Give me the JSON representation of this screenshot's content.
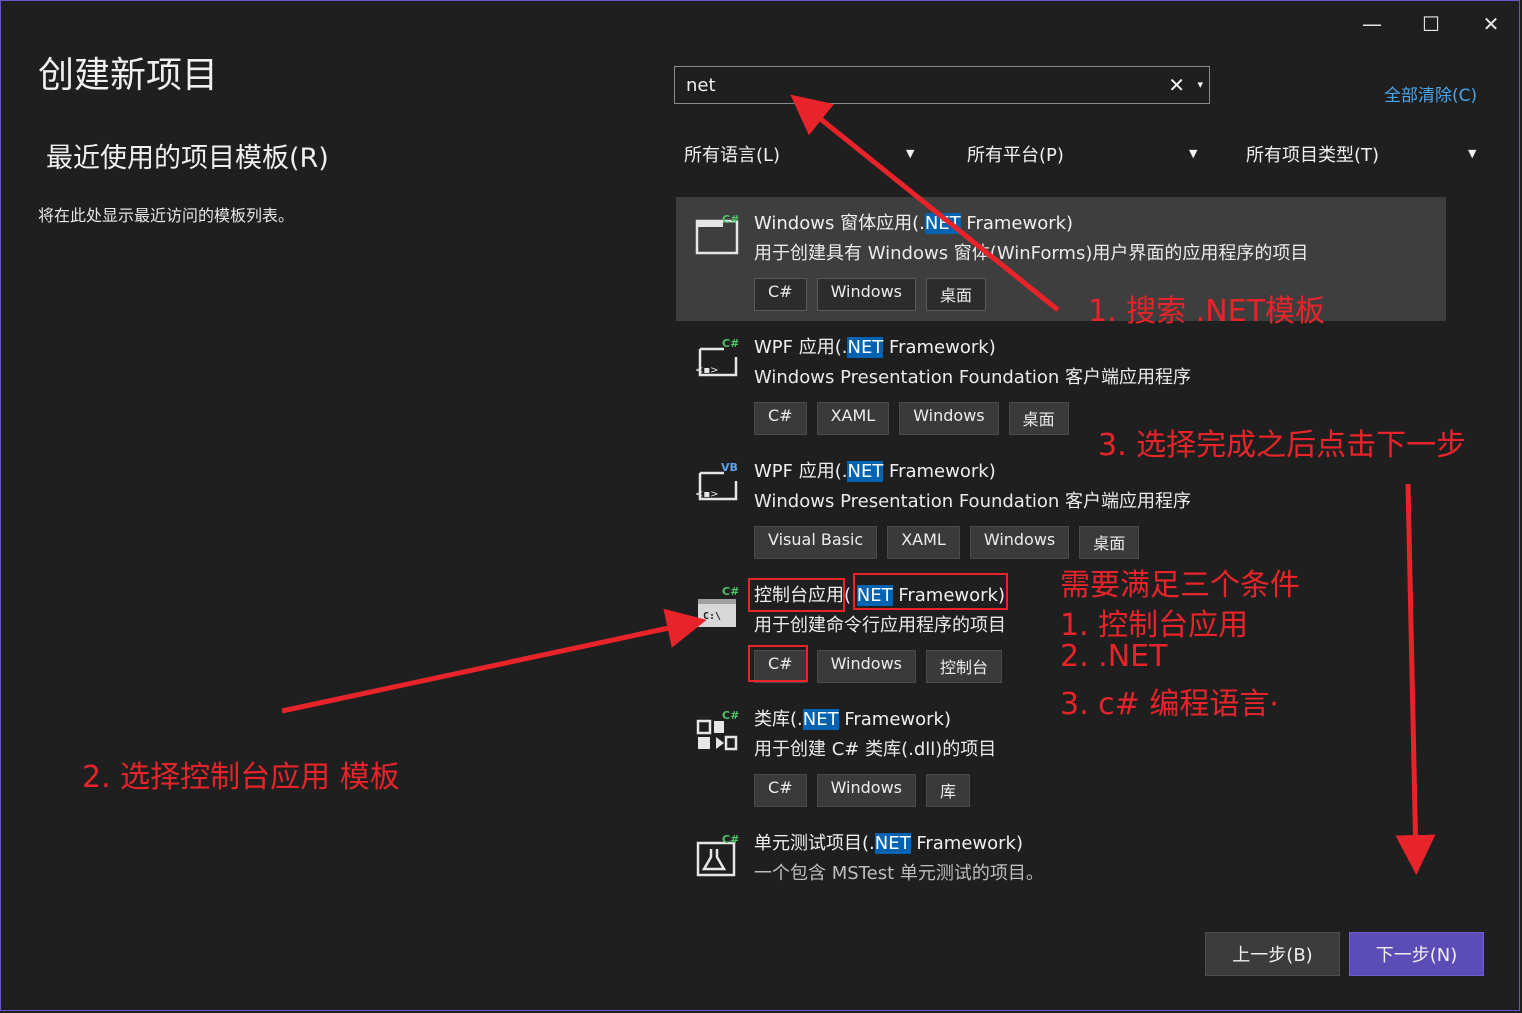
{
  "window": {
    "minimize": "—",
    "maximize": "☐",
    "close": "✕"
  },
  "header": {
    "title": "创建新项目"
  },
  "recent": {
    "heading": "最近使用的项目模板(R)",
    "empty_text": "将在此处显示最近访问的模板列表。"
  },
  "search": {
    "value": "net",
    "clear_icon": "✕",
    "dropdown_icon": "▾",
    "clear_all": "全部清除(C)"
  },
  "filters": [
    {
      "label": "所有语言(L)"
    },
    {
      "label": "所有平台(P)"
    },
    {
      "label": "所有项目类型(T)"
    }
  ],
  "templates": [
    {
      "name_pre": "Windows 窗体应用(.",
      "name_hl": "NET",
      "name_post": " Framework)",
      "desc": "用于创建具有 Windows 窗体(WinForms)用户界面的应用程序的项目",
      "tags": [
        "C#",
        "Windows",
        "桌面"
      ],
      "lang_badge": "C#",
      "selected": true
    },
    {
      "name_pre": "WPF 应用(.",
      "name_hl": "NET",
      "name_post": " Framework)",
      "desc": "Windows Presentation Foundation 客户端应用程序",
      "tags": [
        "C#",
        "XAML",
        "Windows",
        "桌面"
      ],
      "lang_badge": "C#"
    },
    {
      "name_pre": "WPF 应用(.",
      "name_hl": "NET",
      "name_post": " Framework)",
      "desc": "Windows Presentation Foundation 客户端应用程序",
      "tags": [
        "Visual Basic",
        "XAML",
        "Windows",
        "桌面"
      ],
      "lang_badge": "VB"
    },
    {
      "name_pre": "控制台应用(.",
      "name_hl": "NET",
      "name_post": " Framework)",
      "desc": "用于创建命令行应用程序的项目",
      "tags": [
        "C#",
        "Windows",
        "控制台"
      ],
      "lang_badge": "C#"
    },
    {
      "name_pre": "类库(.",
      "name_hl": "NET",
      "name_post": " Framework)",
      "desc": "用于创建 C# 类库(.dll)的项目",
      "tags": [
        "C#",
        "Windows",
        "库"
      ],
      "lang_badge": "C#"
    },
    {
      "name_pre": "单元测试项目(.",
      "name_hl": "NET",
      "name_post": " Framework)",
      "desc": "一个包含 MSTest 单元测试的项目。",
      "tags": [],
      "lang_badge": "C#"
    }
  ],
  "buttons": {
    "prev": "上一步(B)",
    "next": "下一步(N)"
  },
  "annotations": {
    "step1": "1. 搜索 .NET模板",
    "step2": "2. 选择控制台应用 模板",
    "step3": "3. 选择完成之后点击下一步",
    "conditions": [
      "需要满足三个条件",
      "1. 控制台应用",
      "2. .NET",
      "3. c# 编程语言·"
    ]
  },
  "colors": {
    "accent": "#5b4cb6",
    "annotation": "#e8242a",
    "highlight": "#0063b1",
    "link": "#4aa5ea"
  }
}
